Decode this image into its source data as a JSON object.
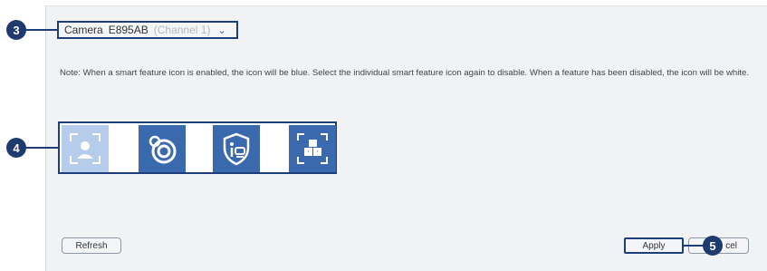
{
  "camera": {
    "label": "Camera",
    "value": "E895AB",
    "channel": "(Channel 1)"
  },
  "note": "Note: When a smart feature icon is enabled, the icon will be blue. Select the individual smart feature icon again to disable. When a feature has been disabled, the icon will be white.",
  "features": [
    {
      "icon": "person-detection-icon",
      "enabled": false
    },
    {
      "icon": "face-recognition-icon",
      "enabled": true
    },
    {
      "icon": "vehicle-detection-icon",
      "enabled": true
    },
    {
      "icon": "object-detection-icon",
      "enabled": true
    }
  ],
  "buttons": {
    "refresh": "Refresh",
    "apply": "Apply",
    "cancel_visible": "cel"
  },
  "callouts": {
    "c3": "3",
    "c4": "4",
    "c5": "5"
  },
  "colors": {
    "enabled_tile": "#3b69ad",
    "disabled_tile": "#b5cdea",
    "callout": "#1f3a6e",
    "highlight_border": "#1e3d7b"
  }
}
